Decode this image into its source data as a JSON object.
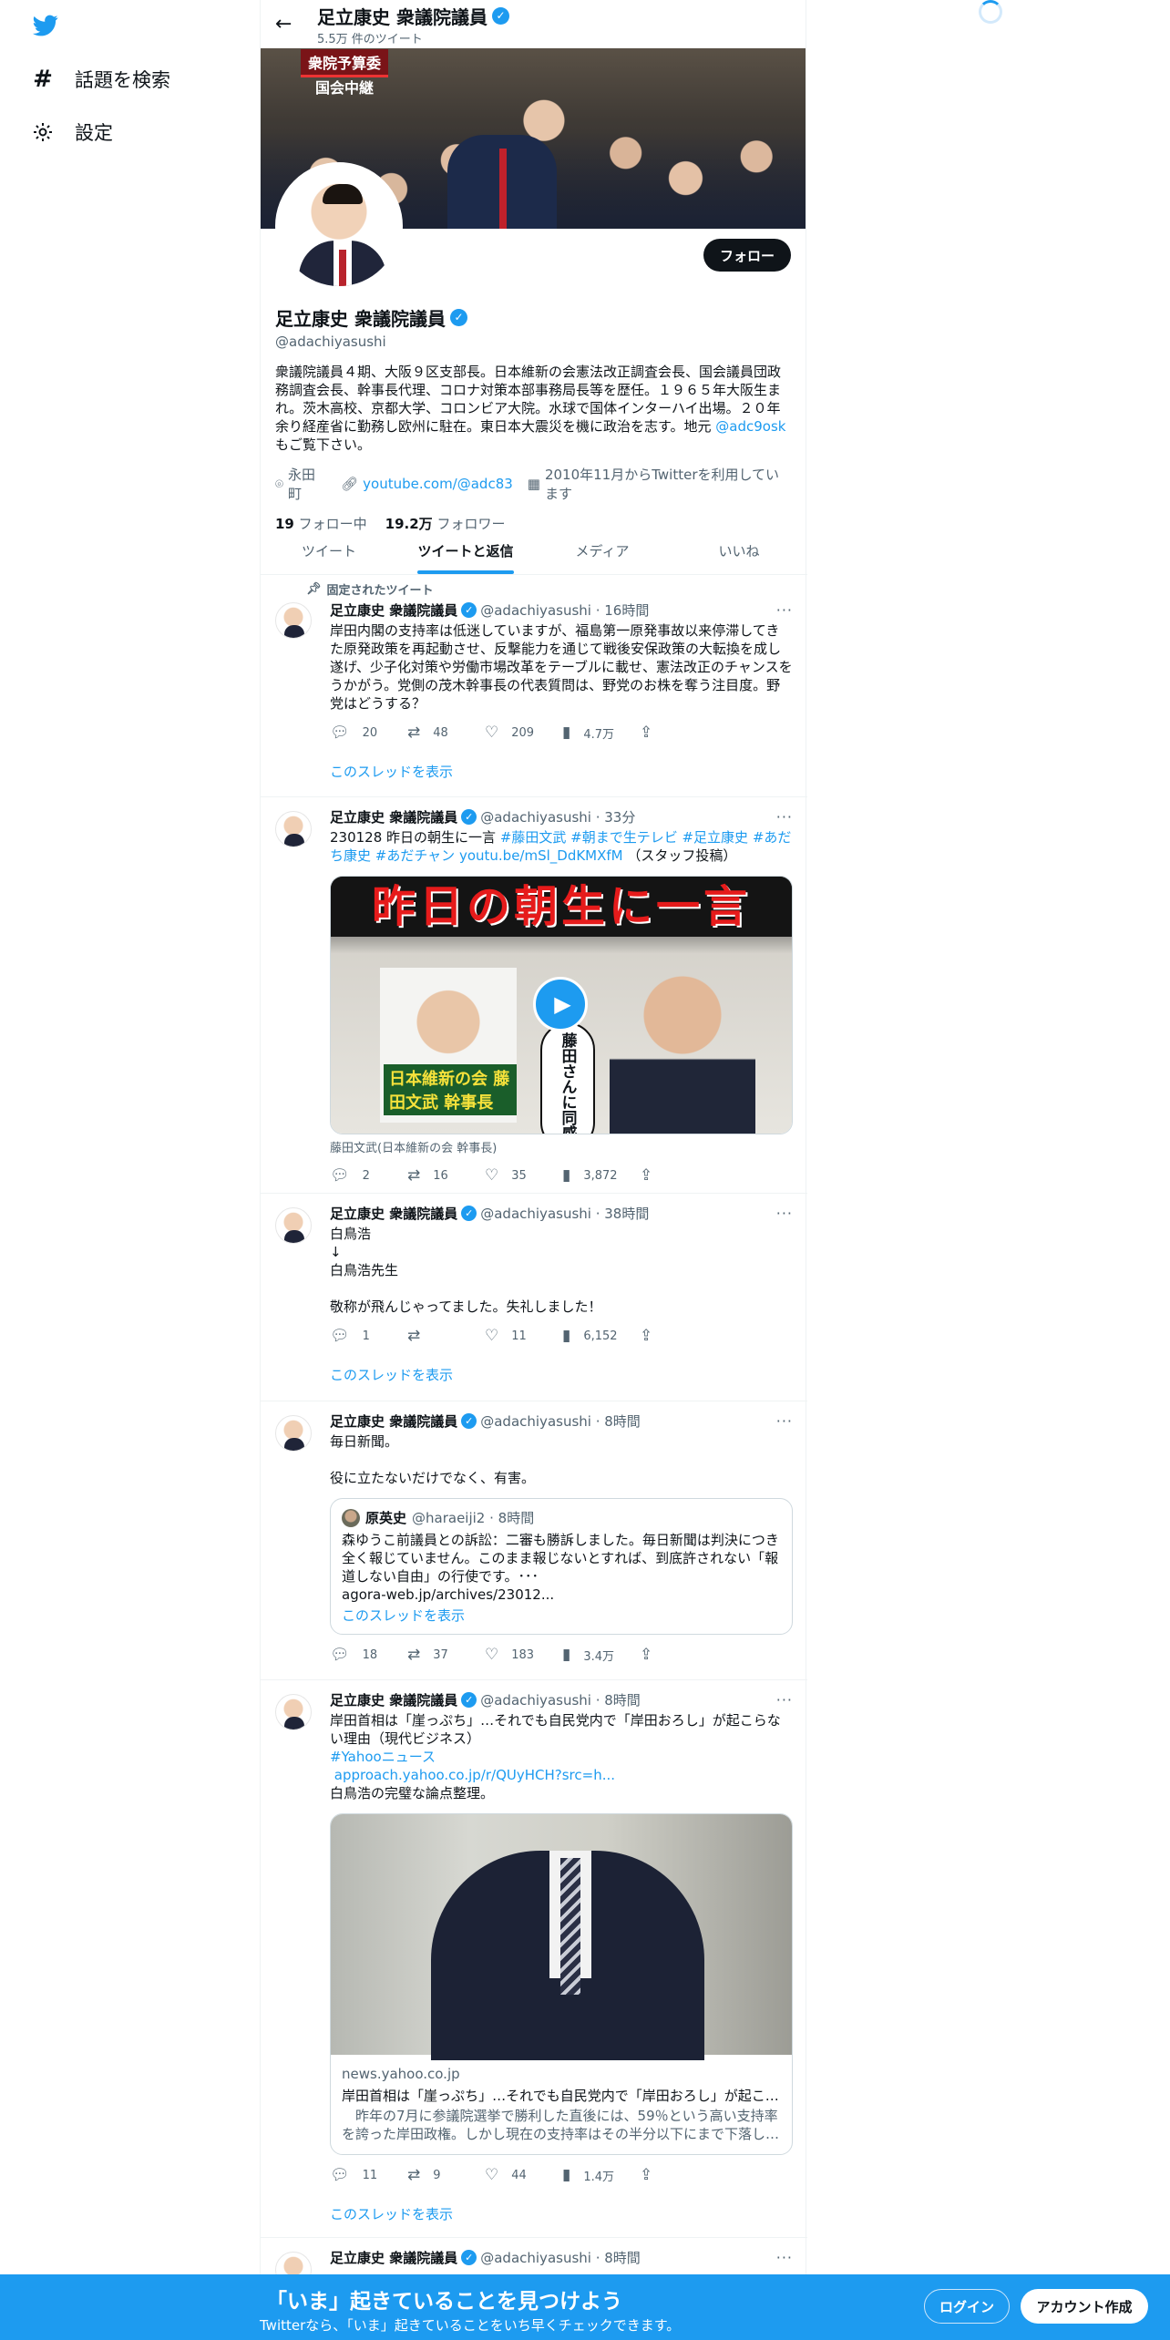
{
  "nav": {
    "logo": "twitter-bird-icon",
    "items": [
      {
        "label": "話題を検索",
        "icon": "hashtag-icon"
      },
      {
        "label": "設定",
        "icon": "gear-icon"
      }
    ]
  },
  "header": {
    "name": "足立康史 衆議院議員",
    "tweet_count": "5.5万 件のツイート"
  },
  "banner": {
    "tag1": "衆院予算委",
    "tag2": "国会中継"
  },
  "profile": {
    "follow_label": "フォロー",
    "name": "足立康史 衆議院議員",
    "handle": "@adachiyasushi",
    "bio": "衆議院議員４期、大阪９区支部長。日本維新の会憲法改正調査会長、国会議員団政務調査会長、幹事長代理、コロナ対策本部事務局長等を歴任。１９６５年大阪生まれ。茨木高校、京都大学、コロンビア大院。水球で国体インターハイ出場。２０年余り経産省に勤務し欧州に駐在。東日本大震災を機に政治を志す。地元 ",
    "bio_link": "@adc9osk",
    "bio_end": "\nもご覧下さい。",
    "location": "永田町",
    "url": "youtube.com/@adc83",
    "joined": "2010年11月からTwitterを利用しています",
    "following_num": "19",
    "following_label": "フォロー中",
    "followers_num": "19.2万",
    "followers_label": "フォロワー"
  },
  "tabs": [
    "ツイート",
    "ツイートと返信",
    "メディア",
    "いいね"
  ],
  "tweets": [
    {
      "pinned_label": "固定されたツイート",
      "name": "足立康史 衆議院議員",
      "handle_time": "@adachiyasushi · 16時間",
      "text": "岸田内閣の支持率は低迷していますが、福島第一原発事故以来停滞してきた原発政策を再起動させ、反撃能力を通じて戦後安保政策の大転換を成し遂げ、少子化対策や労働市場改革をテーブルに載せ、憲法改正のチャンスをうかがう。党側の茂木幹事長の代表質問は、野党のお株を奪う注目度。野党はどうする？",
      "replies": "20",
      "retweets": "48",
      "likes": "209",
      "views": "4.7万",
      "thread": "このスレッドを表示"
    },
    {
      "name": "足立康史 衆議院議員",
      "handle_time": "@adachiyasushi · 33分",
      "text_pre": "230128 昨日の朝生に一言 ",
      "text_tags": "#藤田文武 #朝まで生テレビ #足立康史 #あだち康史 #あだチャン youtu.be/mSl_DdKMXfM",
      "text_post": "（スタッフ投稿）",
      "video_title": "昨日の朝生に一言",
      "video_caption": "日本維新の会 藤田文武 幹事長",
      "video_bubble": "藤田さんに同感",
      "media_caption": "藤田文武(日本維新の会 幹事長)",
      "replies": "2",
      "retweets": "16",
      "likes": "35",
      "views": "3,872"
    },
    {
      "name": "足立康史 衆議院議員",
      "handle_time": "@adachiyasushi · 38時間",
      "text": "白鳥浩\n↓\n白鳥浩先生\n\n敬称が飛んじゃってました。失礼しました！",
      "replies": "1",
      "retweets": "",
      "likes": "11",
      "views": "6,152",
      "thread": "このスレッドを表示"
    },
    {
      "name": "足立康史 衆議院議員",
      "handle_time": "@adachiyasushi · 8時間",
      "text": "毎日新聞。\n\n役に立たないだけでなく、有害。",
      "quote_name": "原英史",
      "quote_handle_time": "@haraeiji2 · 8時間",
      "quote_text": "森ゆうこ前議員との訴訟：二審も勝訴しました。毎日新聞は判決につき全く報じていません。このまま報じないとすれば、到底許されない「報道しない自由」の行使です。･･･\nagora-web.jp/archives/23012...",
      "quote_thread": "このスレッドを表示",
      "replies": "18",
      "retweets": "37",
      "likes": "183",
      "views": "3.4万"
    },
    {
      "name": "足立康史 衆議院議員",
      "handle_time": "@adachiyasushi · 8時間",
      "text_pre": "岸田首相は「崖っぷち」…それでも自民党内で「岸田おろし」が起こらない理由（現代ビジネス）\n",
      "text_tags": "#Yahooニュース\n approach.yahoo.co.jp/r/QUyHCH?src=h...",
      "text_post": "\n白鳥浩の完璧な論点整理。",
      "card_domain": "news.yahoo.co.jp",
      "card_title": "岸田首相は「崖っぷち」…それでも自民党内で「岸田おろし」が起こ…",
      "card_desc": "　昨年の7月に参議院選挙で勝利した直後には、59％という高い支持率を誇った岸田政権。しかし現在の支持率はその半分以下にまで下落し…",
      "replies": "11",
      "retweets": "9",
      "likes": "44",
      "views": "1.4万",
      "thread": "このスレッドを表示"
    },
    {
      "name": "足立康史 衆議院議員",
      "handle_time": "@adachiyasushi · 8時間"
    }
  ],
  "bottom": {
    "headline": "「いま」起きていることを見つけよう",
    "sub": "Twitterなら、「いま」起きていることをいち早くチェックできます。",
    "login": "ログイン",
    "signup": "アカウント作成"
  },
  "colors": {
    "accent": "#1d9bf0",
    "text": "#0f1419",
    "muted": "#536471"
  }
}
